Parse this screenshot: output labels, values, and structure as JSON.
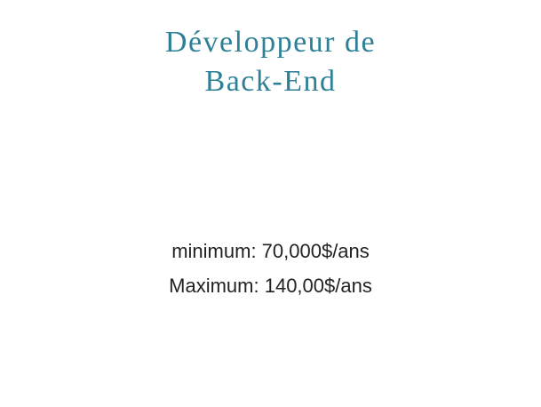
{
  "slide": {
    "title_line1": "Développeur de",
    "title_line2": "Back-End",
    "minimum": "minimum: 70,000$/ans",
    "maximum": "Maximum: 140,00$/ans"
  },
  "colors": {
    "title": "#2e8096",
    "body_text": "#222222",
    "background": "#ffffff"
  }
}
